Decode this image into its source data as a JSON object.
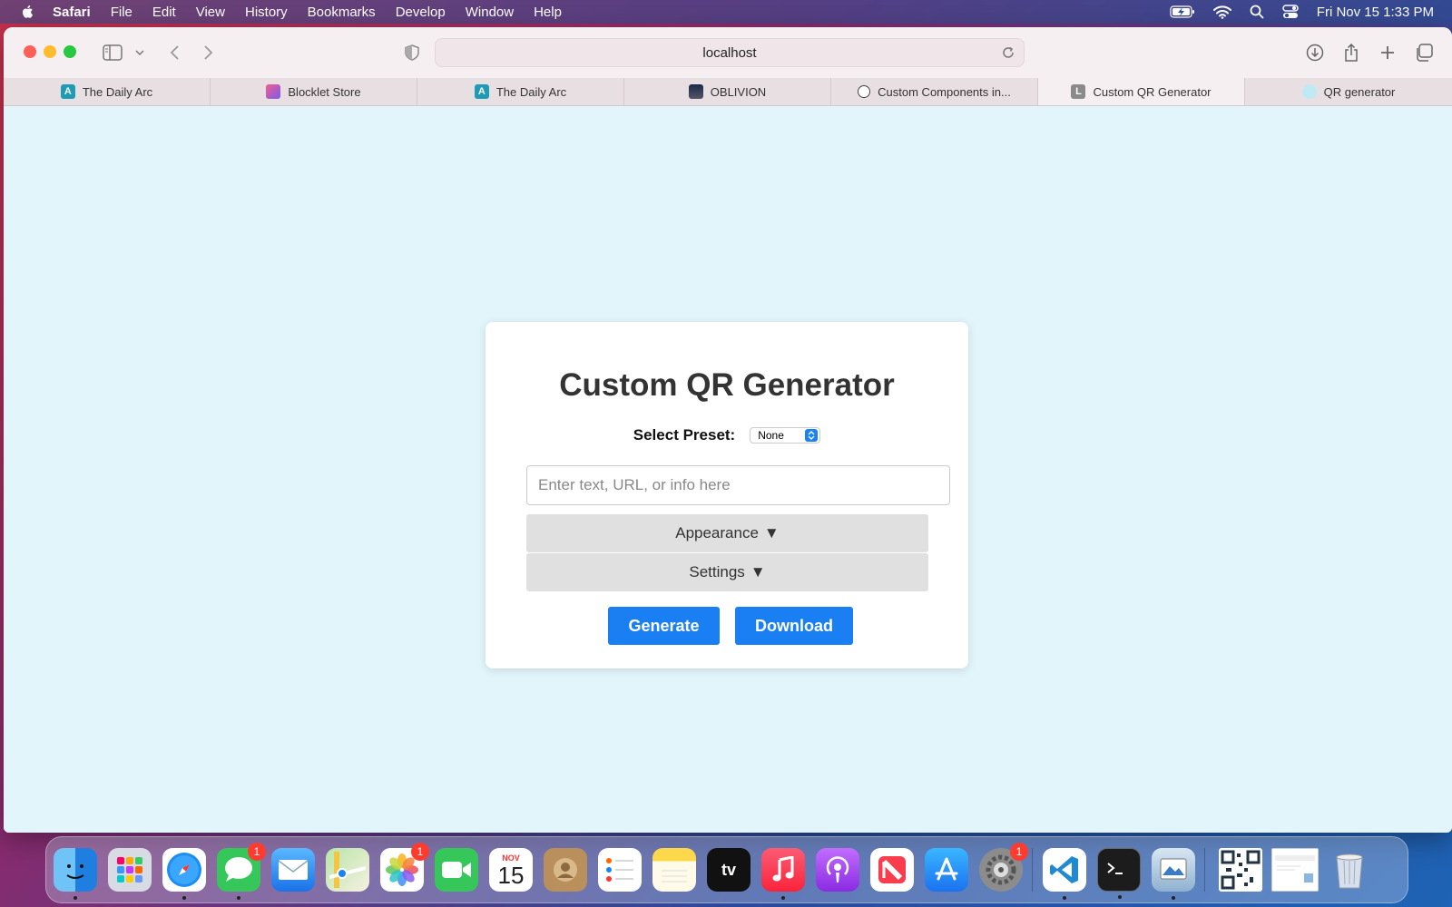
{
  "menubar": {
    "app": "Safari",
    "items": [
      "File",
      "Edit",
      "View",
      "History",
      "Bookmarks",
      "Develop",
      "Window",
      "Help"
    ],
    "clock": "Fri Nov 15  1:33 PM",
    "icons": [
      "battery-charging-icon",
      "wifi-icon",
      "spotlight-search-icon",
      "control-center-icon"
    ]
  },
  "browser": {
    "url": "localhost",
    "tabs": [
      {
        "label": "The Daily Arc",
        "favicon": "A",
        "color": "#1e9bb5",
        "active": false
      },
      {
        "label": "Blocklet Store",
        "favicon": "",
        "color": "#e8477a",
        "active": false
      },
      {
        "label": "The Daily Arc",
        "favicon": "A",
        "color": "#1e9bb5",
        "active": false
      },
      {
        "label": "OBLIVION",
        "favicon": "",
        "color": "#333333",
        "active": false
      },
      {
        "label": "Custom Components in...",
        "favicon": "",
        "color": "#555555",
        "active": false
      },
      {
        "label": "Custom QR Generator",
        "favicon": "L",
        "color": "#8a8a8a",
        "active": true
      },
      {
        "label": "QR generator",
        "favicon": "",
        "color": "#5ec8e0",
        "active": false
      }
    ]
  },
  "page": {
    "title": "Custom QR Generator",
    "preset_label": "Select Preset:",
    "preset_value": "None",
    "input_placeholder": "Enter text, URL, or info here",
    "input_value": "",
    "appearance_label": "Appearance",
    "settings_label": "Settings",
    "triangle": "▼",
    "generate_label": "Generate",
    "download_label": "Download",
    "accent": "#1a7ff2",
    "background": "#e1f5fb"
  },
  "dock": {
    "november_label": "NOV",
    "day": "15",
    "messages_badge": "1",
    "photos_badge": "1",
    "settings_badge": "1",
    "tv_label": "tv"
  }
}
